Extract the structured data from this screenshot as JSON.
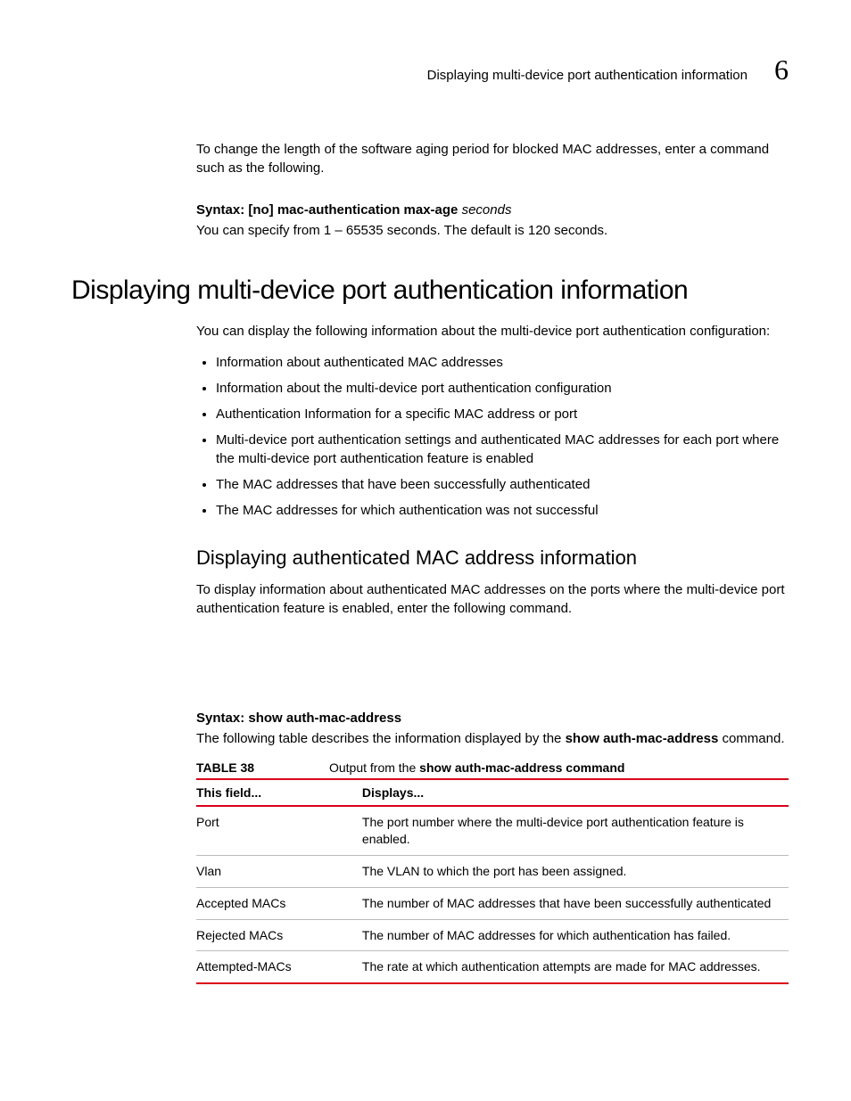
{
  "runningHead": {
    "text": "Displaying multi-device port authentication information",
    "chapter": "6"
  },
  "intro": {
    "para1": "To change the length of the software aging period for blocked MAC addresses, enter a command such as the following.",
    "syntaxPrefix": "Syntax:  ",
    "syntaxBold": "[no] mac-authentication max-age",
    "syntaxItalic": " seconds",
    "para2": "You can specify from 1 – 65535 seconds. The default is 120 seconds."
  },
  "section": {
    "title": "Displaying multi-device port authentication information",
    "lead": "You can display the following information about the multi-device port authentication configuration:",
    "bullets": [
      "Information about authenticated MAC addresses",
      "Information about the multi-device port authentication configuration",
      "Authentication Information for a specific MAC address or port",
      "Multi-device port authentication settings and authenticated MAC addresses for each port where the multi-device port authentication feature is enabled",
      "The MAC addresses that have been successfully authenticated",
      "The MAC addresses for which authentication was not successful"
    ]
  },
  "subsection": {
    "title": "Displaying authenticated MAC address information",
    "para": "To display information about authenticated MAC addresses on the ports where the multi-device port authentication feature is enabled, enter the following command.",
    "syntaxPrefix": "Syntax:  ",
    "syntaxBold": "show auth-mac-address",
    "followPrefix": "The following table describes the information displayed by the ",
    "followBold": "show auth-mac-address",
    "followSuffix": " command."
  },
  "table": {
    "label": "TABLE 38",
    "captionPrefix": "Output from the ",
    "captionBold": "show auth-mac-address command",
    "head": {
      "col1": "This field...",
      "col2": "Displays..."
    },
    "rows": [
      {
        "field": "Port",
        "desc": "The port number where the multi-device port authentication feature is enabled."
      },
      {
        "field": "Vlan",
        "desc": "The VLAN to which the port has been assigned."
      },
      {
        "field": "Accepted MACs",
        "desc": "The number of MAC addresses that have been successfully authenticated"
      },
      {
        "field": "Rejected MACs",
        "desc": "The number of MAC addresses for which authentication has failed."
      },
      {
        "field": "Attempted-MACs",
        "desc": "The rate at which authentication attempts are made for MAC addresses."
      }
    ]
  }
}
